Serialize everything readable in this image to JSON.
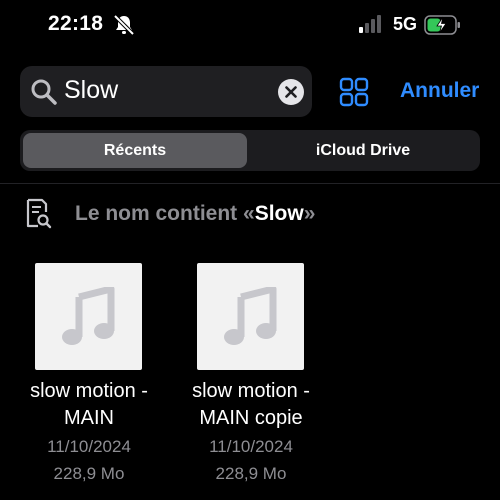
{
  "status_bar": {
    "time": "22:18",
    "network": "5G",
    "icons": [
      "bell-slash-icon",
      "signal-bars-icon",
      "battery-charging-icon"
    ],
    "battery_color": "#34c759"
  },
  "search": {
    "query": "Slow",
    "cancel_label": "Annuler",
    "icons": [
      "search-icon",
      "clear-icon",
      "grid-view-icon"
    ],
    "accent_color": "#2f8cff"
  },
  "segments": [
    {
      "label": "Récents",
      "selected": true
    },
    {
      "label": "iCloud Drive",
      "selected": false
    }
  ],
  "filter": {
    "prefix": "Le nom contient «",
    "term": "Slow",
    "suffix": "»",
    "icon": "document-search-icon"
  },
  "files": [
    {
      "name_line1": "slow motion -",
      "name_line2": "MAIN",
      "date": "11/10/2024",
      "size": "228,9 Mo",
      "icon": "music-note-icon"
    },
    {
      "name_line1": "slow motion -",
      "name_line2": "MAIN copie",
      "date": "11/10/2024",
      "size": "228,9 Mo",
      "icon": "music-note-icon"
    }
  ]
}
